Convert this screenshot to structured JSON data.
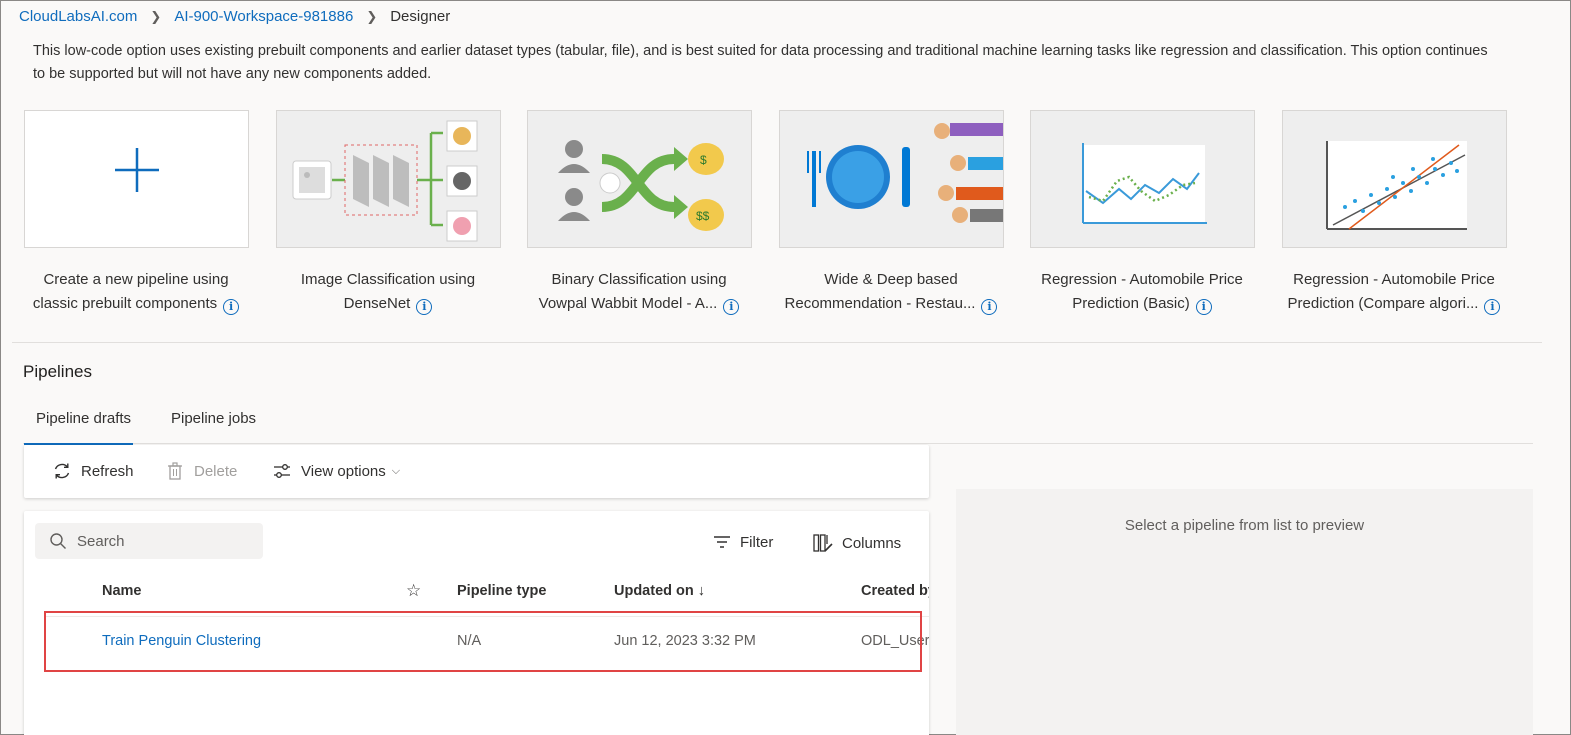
{
  "breadcrumb": {
    "items": [
      "CloudLabsAI.com",
      "AI-900-Workspace-981886"
    ],
    "current": "Designer"
  },
  "description": "This low-code option uses existing prebuilt components and earlier dataset types (tabular, file), and is best suited for data processing and traditional machine learning tasks like regression and classification. This option continues to be supported but will not have any new components added.",
  "cards": [
    {
      "line1": "Create a new pipeline using",
      "line2": "classic prebuilt components",
      "icon": "plus-icon"
    },
    {
      "line1": "Image Classification using",
      "line2": "DenseNet",
      "icon": "image-classification-thumbnail"
    },
    {
      "line1": "Binary Classification using",
      "line2": "Vowpal Wabbit Model - A...",
      "icon": "binary-classification-thumbnail"
    },
    {
      "line1": "Wide & Deep based",
      "line2": "Recommendation - Restau...",
      "icon": "recommendation-thumbnail"
    },
    {
      "line1": "Regression - Automobile Price",
      "line2": "Prediction (Basic)",
      "icon": "line-chart-thumbnail"
    },
    {
      "line1": "Regression - Automobile Price",
      "line2": "Prediction (Compare algori...",
      "icon": "scatter-regression-thumbnail"
    }
  ],
  "pipelines": {
    "title": "Pipelines",
    "tabs": [
      "Pipeline drafts",
      "Pipeline jobs"
    ],
    "toolbar": {
      "refresh": "Refresh",
      "delete": "Delete",
      "view_options": "View options"
    },
    "search_placeholder": "Search",
    "filter": "Filter",
    "columns": "Columns",
    "headers": {
      "name": "Name",
      "pipeline_type": "Pipeline type",
      "updated_on": "Updated on ↓",
      "created_by": "Created by"
    },
    "rows": [
      {
        "name": "Train Penguin Clustering",
        "pipeline_type": "N/A",
        "updated_on": "Jun 12, 2023 3:32 PM",
        "created_by": "ODL_User"
      }
    ],
    "preview_text": "Select a pipeline from list to preview"
  },
  "colors": {
    "accent": "#0f6cbd",
    "highlight": "#e04444"
  }
}
